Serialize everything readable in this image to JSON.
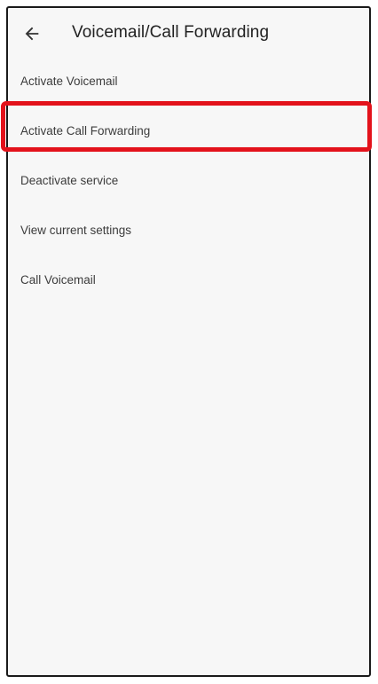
{
  "header": {
    "title": "Voicemail/Call Forwarding",
    "back_icon": "arrow-left-icon"
  },
  "menu": {
    "items": [
      {
        "label": "Activate Voicemail"
      },
      {
        "label": "Activate Call Forwarding"
      },
      {
        "label": "Deactivate service"
      },
      {
        "label": "View current settings"
      },
      {
        "label": "Call Voicemail"
      }
    ],
    "highlighted_item": "Activate Call Forwarding"
  },
  "colors": {
    "highlight": "#e3121b",
    "background": "#f7f7f7",
    "text": "#3c3c3c"
  }
}
